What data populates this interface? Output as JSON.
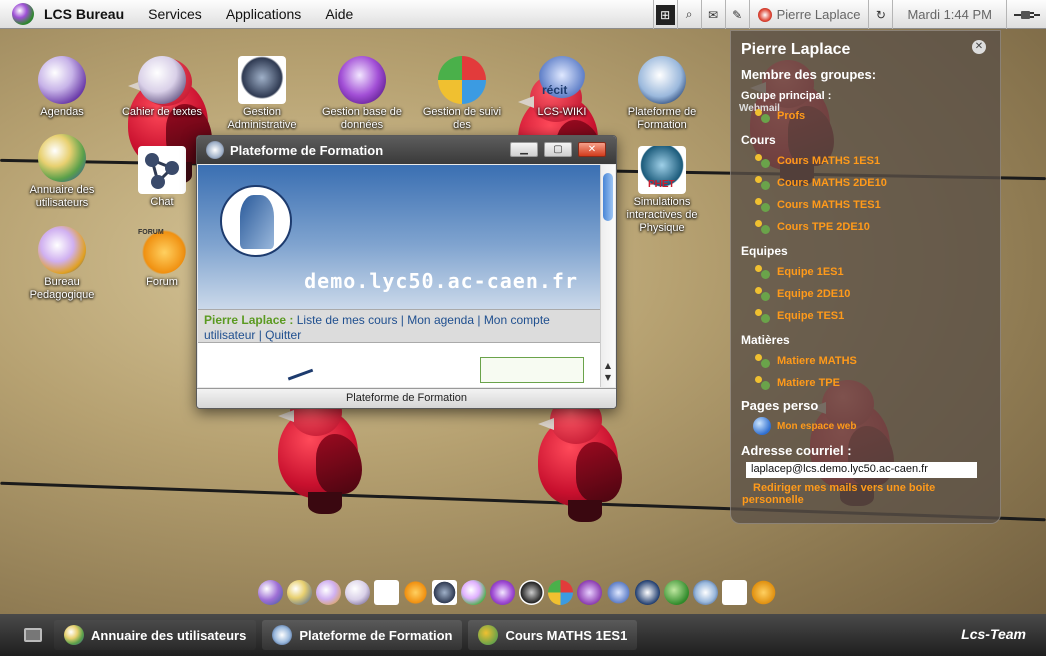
{
  "menubar": {
    "brand": "LCS Bureau",
    "menus": [
      "Services",
      "Applications",
      "Aide"
    ],
    "user": "Pierre Laplace",
    "clock": "Mardi 1:44 PM"
  },
  "desktop_icons": [
    {
      "label": "Agendas"
    },
    {
      "label": "Cahier de textes"
    },
    {
      "label": "Gestion Administrative"
    },
    {
      "label": "Gestion base de données"
    },
    {
      "label": "Gestion de suivi des"
    },
    {
      "label": "LCS-WIKI"
    },
    {
      "label": "Plateforme de Formation"
    },
    {
      "label": "Annuaire des utilisateurs"
    },
    {
      "label": "Chat"
    },
    {
      "label": "Simulations interactives de Physique"
    },
    {
      "label": "Bureau Pedagogique"
    },
    {
      "label": "Forum"
    }
  ],
  "icon_badges": {
    "recit": "récit",
    "phet": "PHET",
    "forum": "FORUM",
    "webmail": "Webmail"
  },
  "window": {
    "title": "Plateforme de Formation",
    "domain": "demo.lyc50.ac-caen.fr",
    "user_name": "Pierre Laplace :",
    "link_courses": "Liste de mes cours",
    "link_agenda": "Mon agenda",
    "link_account": "Mon compte utilisateur",
    "link_quit": "Quitter",
    "separator": "|",
    "status": "Plateforme de Formation"
  },
  "panel": {
    "name": "Pierre Laplace",
    "groups_title": "Membre des groupes:",
    "main_group_title": "Goupe principal :",
    "main_group": "Profs",
    "courses_title": "Cours",
    "courses": [
      "Cours MATHS 1ES1",
      "Cours MATHS 2DE10",
      "Cours MATHS TES1",
      "Cours TPE 2DE10"
    ],
    "teams_title": "Equipes",
    "teams": [
      "Equipe 1ES1",
      "Equipe 2DE10",
      "Equipe TES1"
    ],
    "subjects_title": "Matières",
    "subjects": [
      "Matiere MATHS",
      "Matiere TPE"
    ],
    "pages_title": "Pages perso",
    "web_space": "Mon espace web",
    "email_title": "Adresse courriel :",
    "email": "laplacep@lcs.demo.lyc50.ac-caen.fr",
    "redirect_line1": "Rediriger mes mails vers une boite",
    "redirect_line2": "personnelle"
  },
  "taskbar": {
    "tasks": [
      "Annuaire des utilisateurs",
      "Plateforme de Formation",
      "Cours MATHS 1ES1"
    ],
    "team": "Lcs-Team"
  },
  "colors": {
    "accent_orange": "#ff9a1a",
    "link_blue": "#1f4f8f",
    "username_green": "#5b9a21"
  }
}
